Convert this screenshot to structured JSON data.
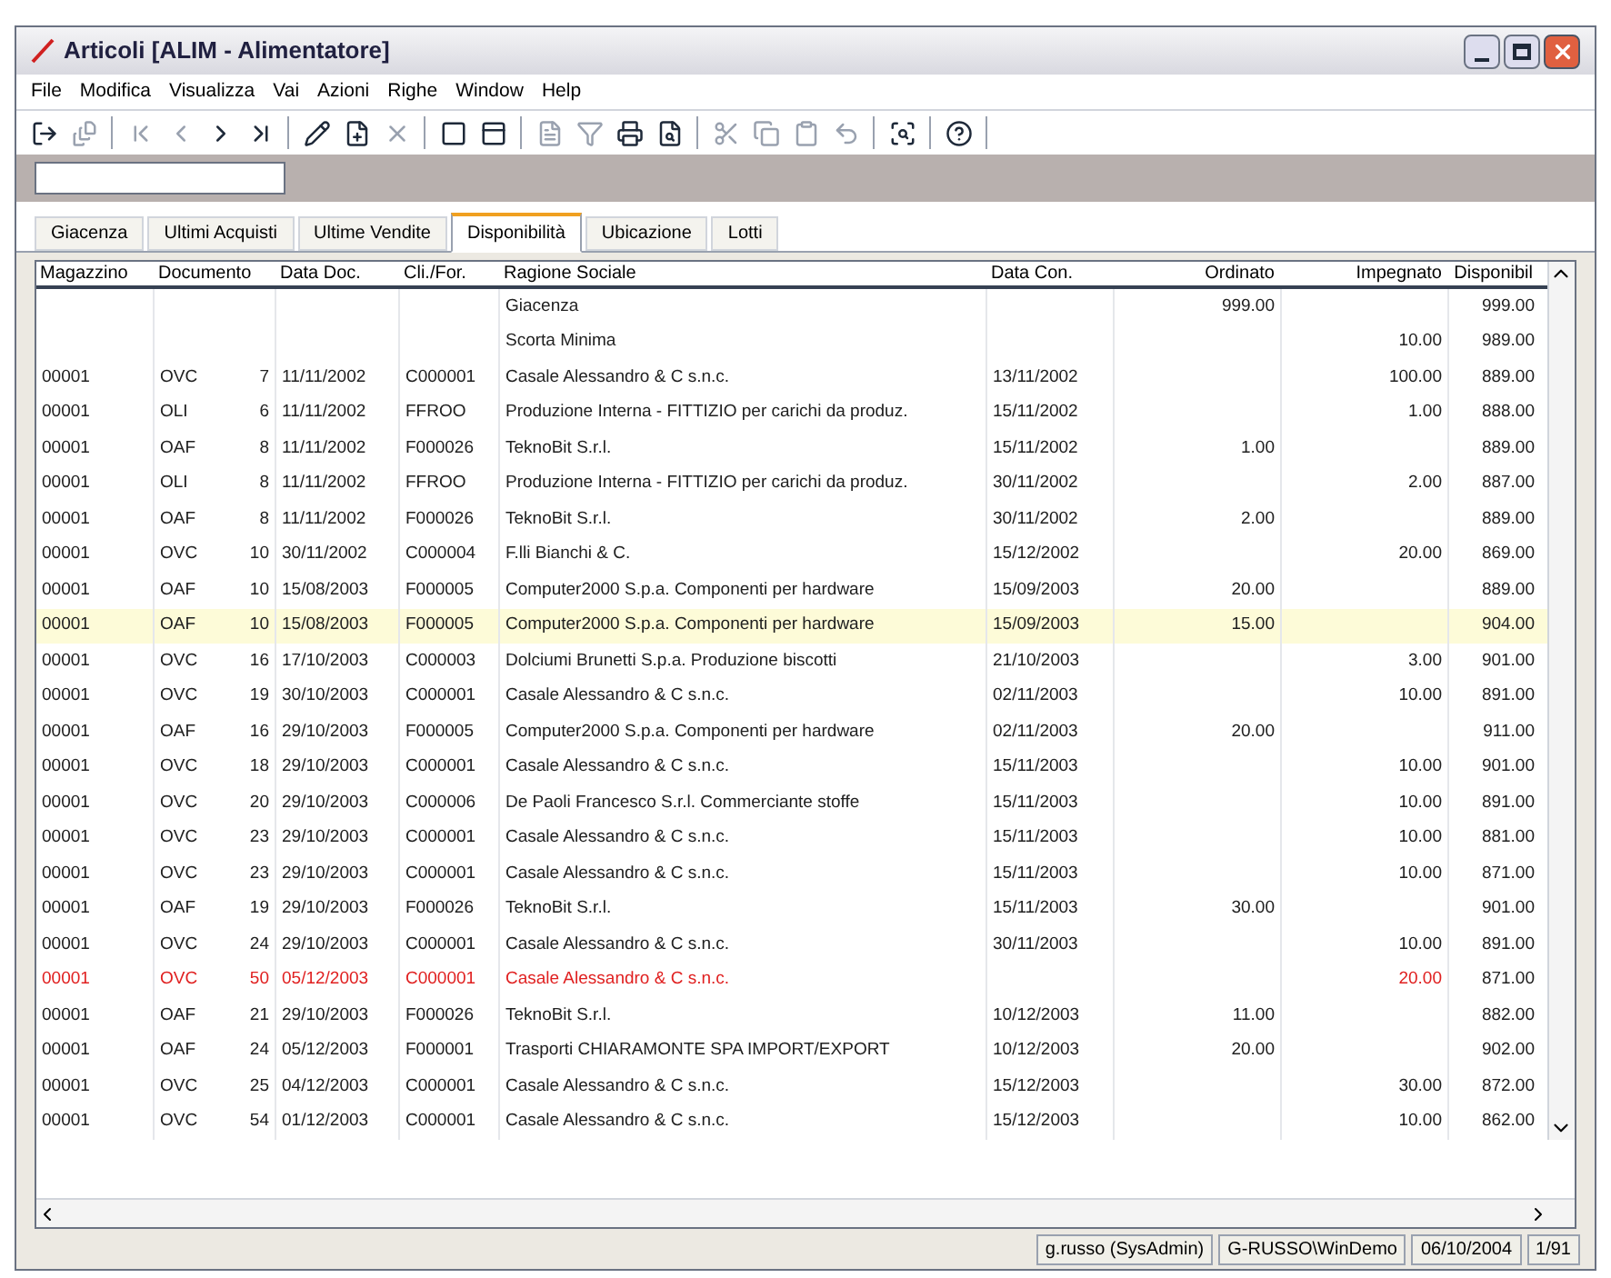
{
  "window": {
    "title": "Articoli [ALIM - Alimentatore]"
  },
  "menu": [
    "File",
    "Modifica",
    "Visualizza",
    "Vai",
    "Azioni",
    "Righe",
    "Window",
    "Help"
  ],
  "tabs": [
    {
      "label": "Giacenza",
      "selected": false
    },
    {
      "label": "Ultimi Acquisti",
      "selected": false
    },
    {
      "label": "Ultime Vendite",
      "selected": false
    },
    {
      "label": "Disponibilità",
      "selected": true
    },
    {
      "label": "Ubicazione",
      "selected": false
    },
    {
      "label": "Lotti",
      "selected": false
    }
  ],
  "table": {
    "columns": [
      "Magazzino",
      "Documento",
      "Data Doc.",
      "Cli./For.",
      "Ragione Sociale",
      "Data Con.",
      "Ordinato",
      "Impegnato",
      "Disponibil"
    ],
    "rows": [
      {
        "kind": "normal",
        "selected": false,
        "cells": [
          "",
          "",
          "",
          "",
          "Giacenza",
          "",
          "999.00",
          "",
          "999.00"
        ]
      },
      {
        "kind": "normal",
        "selected": false,
        "cells": [
          "",
          "",
          "",
          "",
          "Scorta Minima",
          "",
          "",
          "10.00",
          "989.00"
        ]
      },
      {
        "kind": "normal",
        "selected": false,
        "cells": [
          "00001",
          {
            "type": "OVC",
            "number": "7"
          },
          "11/11/2002",
          "C000001",
          "Casale Alessandro & C s.n.c.",
          "13/11/2002",
          "",
          "100.00",
          "889.00"
        ]
      },
      {
        "kind": "normal",
        "selected": false,
        "cells": [
          "00001",
          {
            "type": "OLI",
            "number": "6"
          },
          "11/11/2002",
          "FFROO",
          "Produzione Interna - FITTIZIO per carichi da produz.",
          "15/11/2002",
          "",
          "1.00",
          "888.00"
        ]
      },
      {
        "kind": "normal",
        "selected": false,
        "cells": [
          "00001",
          {
            "type": "OAF",
            "number": "8"
          },
          "11/11/2002",
          "F000026",
          "TeknoBit S.r.l.",
          "15/11/2002",
          "1.00",
          "",
          "889.00"
        ]
      },
      {
        "kind": "normal",
        "selected": false,
        "cells": [
          "00001",
          {
            "type": "OLI",
            "number": "8"
          },
          "11/11/2002",
          "FFROO",
          "Produzione Interna - FITTIZIO per carichi da produz.",
          "30/11/2002",
          "",
          "2.00",
          "887.00"
        ]
      },
      {
        "kind": "normal",
        "selected": false,
        "cells": [
          "00001",
          {
            "type": "OAF",
            "number": "8"
          },
          "11/11/2002",
          "F000026",
          "TeknoBit S.r.l.",
          "30/11/2002",
          "2.00",
          "",
          "889.00"
        ]
      },
      {
        "kind": "normal",
        "selected": false,
        "cells": [
          "00001",
          {
            "type": "OVC",
            "number": "10"
          },
          "30/11/2002",
          "C000004",
          "F.lli Bianchi & C.",
          "15/12/2002",
          "",
          "20.00",
          "869.00"
        ]
      },
      {
        "kind": "normal",
        "selected": false,
        "cells": [
          "00001",
          {
            "type": "OAF",
            "number": "10"
          },
          "15/08/2003",
          "F000005",
          "Computer2000 S.p.a. Componenti per hardware",
          "15/09/2003",
          "20.00",
          "",
          "889.00"
        ]
      },
      {
        "kind": "normal",
        "selected": true,
        "cells": [
          "00001",
          {
            "type": "OAF",
            "number": "10"
          },
          "15/08/2003",
          "F000005",
          "Computer2000 S.p.a. Componenti per hardware",
          "15/09/2003",
          "15.00",
          "",
          "904.00"
        ]
      },
      {
        "kind": "normal",
        "selected": false,
        "cells": [
          "00001",
          {
            "type": "OVC",
            "number": "16"
          },
          "17/10/2003",
          "C000003",
          "Dolciumi Brunetti S.p.a. Produzione biscotti",
          "21/10/2003",
          "",
          "3.00",
          "901.00"
        ]
      },
      {
        "kind": "normal",
        "selected": false,
        "cells": [
          "00001",
          {
            "type": "OVC",
            "number": "19"
          },
          "30/10/2003",
          "C000001",
          "Casale Alessandro & C s.n.c.",
          "02/11/2003",
          "",
          "10.00",
          "891.00"
        ]
      },
      {
        "kind": "normal",
        "selected": false,
        "cells": [
          "00001",
          {
            "type": "OAF",
            "number": "16"
          },
          "29/10/2003",
          "F000005",
          "Computer2000 S.p.a. Componenti per hardware",
          "02/11/2003",
          "20.00",
          "",
          "911.00"
        ]
      },
      {
        "kind": "normal",
        "selected": false,
        "cells": [
          "00001",
          {
            "type": "OVC",
            "number": "18"
          },
          "29/10/2003",
          "C000001",
          "Casale Alessandro & C s.n.c.",
          "15/11/2003",
          "",
          "10.00",
          "901.00"
        ]
      },
      {
        "kind": "normal",
        "selected": false,
        "cells": [
          "00001",
          {
            "type": "OVC",
            "number": "20"
          },
          "29/10/2003",
          "C000006",
          "De Paoli Francesco S.r.l. Commerciante stoffe",
          "15/11/2003",
          "",
          "10.00",
          "891.00"
        ]
      },
      {
        "kind": "normal",
        "selected": false,
        "cells": [
          "00001",
          {
            "type": "OVC",
            "number": "23"
          },
          "29/10/2003",
          "C000001",
          "Casale Alessandro & C s.n.c.",
          "15/11/2003",
          "",
          "10.00",
          "881.00"
        ]
      },
      {
        "kind": "normal",
        "selected": false,
        "cells": [
          "00001",
          {
            "type": "OVC",
            "number": "23"
          },
          "29/10/2003",
          "C000001",
          "Casale Alessandro & C s.n.c.",
          "15/11/2003",
          "",
          "10.00",
          "871.00"
        ]
      },
      {
        "kind": "normal",
        "selected": false,
        "cells": [
          "00001",
          {
            "type": "OAF",
            "number": "19"
          },
          "29/10/2003",
          "F000026",
          "TeknoBit S.r.l.",
          "15/11/2003",
          "30.00",
          "",
          "901.00"
        ]
      },
      {
        "kind": "normal",
        "selected": false,
        "cells": [
          "00001",
          {
            "type": "OVC",
            "number": "24"
          },
          "29/10/2003",
          "C000001",
          "Casale Alessandro & C s.n.c.",
          "30/11/2003",
          "",
          "10.00",
          "891.00"
        ]
      },
      {
        "kind": "alert",
        "selected": false,
        "cells": [
          "00001",
          {
            "type": "OVC",
            "number": "50"
          },
          "05/12/2003",
          "C000001",
          "Casale Alessandro & C s.n.c.",
          "",
          "",
          "20.00",
          "871.00"
        ]
      },
      {
        "kind": "normal",
        "selected": false,
        "cells": [
          "00001",
          {
            "type": "OAF",
            "number": "21"
          },
          "29/10/2003",
          "F000026",
          "TeknoBit S.r.l.",
          "10/12/2003",
          "11.00",
          "",
          "882.00"
        ]
      },
      {
        "kind": "normal",
        "selected": false,
        "cells": [
          "00001",
          {
            "type": "OAF",
            "number": "24"
          },
          "05/12/2003",
          "F000001",
          "Trasporti CHIARAMONTE SPA IMPORT/EXPORT",
          "10/12/2003",
          "20.00",
          "",
          "902.00"
        ]
      },
      {
        "kind": "normal",
        "selected": false,
        "cells": [
          "00001",
          {
            "type": "OVC",
            "number": "25"
          },
          "04/12/2003",
          "C000001",
          "Casale Alessandro & C s.n.c.",
          "15/12/2003",
          "",
          "30.00",
          "872.00"
        ]
      },
      {
        "kind": "normal",
        "selected": false,
        "cells": [
          "00001",
          {
            "type": "OVC",
            "number": "54"
          },
          "01/12/2003",
          "C000001",
          "Casale Alessandro & C s.n.c.",
          "15/12/2003",
          "",
          "10.00",
          "862.00"
        ]
      }
    ]
  },
  "status_bar": [
    "g.russo (SysAdmin)",
    "G-RUSSO\\WinDemo",
    "06/10/2004",
    "1/91"
  ]
}
